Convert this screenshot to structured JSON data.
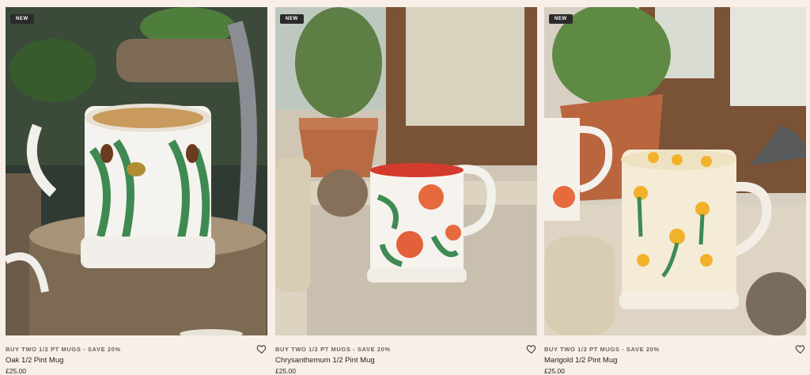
{
  "products": [
    {
      "badge": "NEW",
      "promo": "BUY TWO 1/2 PT MUGS - SAVE 20%",
      "name": "Oak 1/2 Pint Mug",
      "price": "£25.00",
      "image_icon": "mug-photo-oak",
      "wishlist_icon": "heart-outline-icon"
    },
    {
      "badge": "NEW",
      "promo": "BUY TWO 1/2 PT MUGS - SAVE 20%",
      "name": "Chrysanthemum 1/2 Pint Mug",
      "price": "£25.00",
      "image_icon": "mug-photo-chrysanthemum",
      "wishlist_icon": "heart-outline-icon"
    },
    {
      "badge": "NEW",
      "promo": "BUY TWO 1/2 PT MUGS - SAVE 20%",
      "name": "Marigold 1/2 Pint Mug",
      "price": "£25.00",
      "image_icon": "mug-photo-marigold",
      "wishlist_icon": "heart-outline-icon"
    }
  ],
  "colors": {
    "background": "#f7efe8",
    "badge_bg": "#2b2b2b",
    "text": "#2a2522",
    "promo_text": "#6b625d"
  }
}
